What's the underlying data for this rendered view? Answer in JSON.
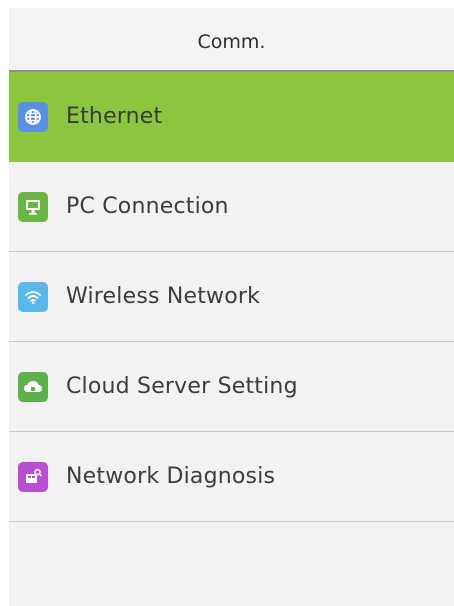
{
  "header": {
    "title": "Comm."
  },
  "menu": {
    "items": [
      {
        "label": "Ethernet",
        "icon": "globe-icon",
        "icon_color": "#5b8fe0",
        "selected": true
      },
      {
        "label": "PC Connection",
        "icon": "monitor-icon",
        "icon_color": "#6ab546",
        "selected": false
      },
      {
        "label": "Wireless Network",
        "icon": "wifi-icon",
        "icon_color": "#5ab7ea",
        "selected": false
      },
      {
        "label": "Cloud Server Setting",
        "icon": "cloud-icon",
        "icon_color": "#5db04a",
        "selected": false
      },
      {
        "label": "Network Diagnosis",
        "icon": "diagnosis-icon",
        "icon_color": "#b64fd0",
        "selected": false
      }
    ]
  },
  "colors": {
    "selected_background": "#8cc63e",
    "row_background": "#f2f2f2",
    "divider": "#c8c8c8"
  }
}
